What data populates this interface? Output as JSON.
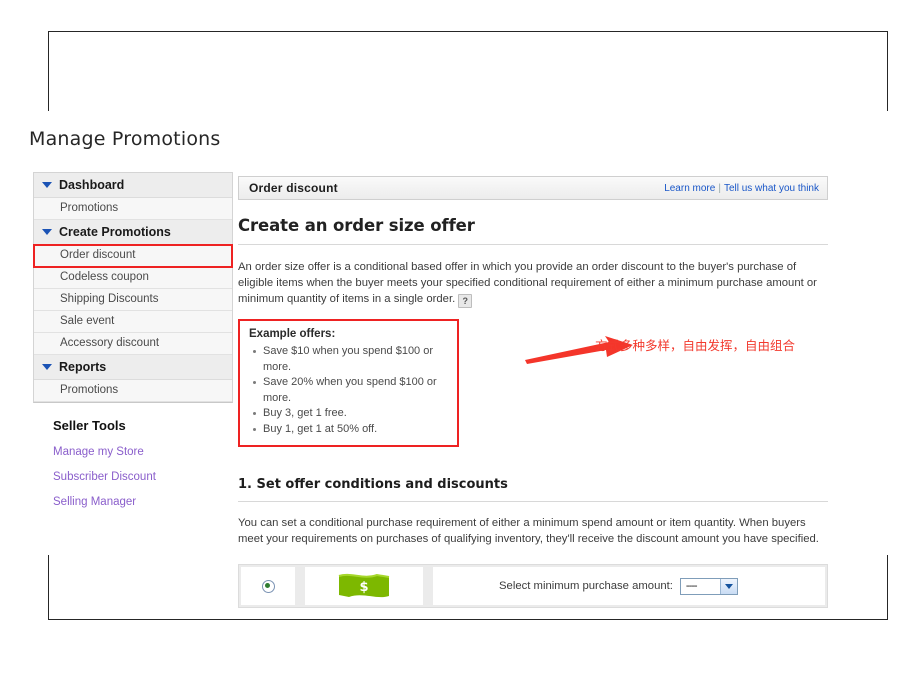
{
  "page": {
    "title": "Manage Promotions"
  },
  "sidebar": {
    "groups": [
      {
        "label": "Dashboard",
        "icon": "triangle-down-icon",
        "items": [
          {
            "label": "Promotions",
            "highlighted": false
          }
        ]
      },
      {
        "label": "Create Promotions",
        "icon": "triangle-down-icon",
        "items": [
          {
            "label": "Order discount",
            "highlighted": true
          },
          {
            "label": "Codeless coupon",
            "highlighted": false
          },
          {
            "label": "Shipping Discounts",
            "highlighted": false
          },
          {
            "label": "Sale event",
            "highlighted": false
          },
          {
            "label": "Accessory discount",
            "highlighted": false
          }
        ]
      },
      {
        "label": "Reports",
        "icon": "triangle-down-icon",
        "items": [
          {
            "label": "Promotions",
            "highlighted": false
          }
        ]
      }
    ],
    "seller_tools": {
      "heading": "Seller Tools",
      "links": [
        "Manage my Store",
        "Subscriber Discount",
        "Selling Manager"
      ]
    }
  },
  "content": {
    "bar": {
      "title": "Order discount",
      "learn_more": "Learn more",
      "separator": "|",
      "feedback": "Tell us what you think"
    },
    "heading": "Create an order size offer",
    "intro": "An order size offer is a conditional based offer in which you provide an order discount to the buyer's purchase of eligible items when the buyer meets your specified conditional requirement of either a minimum purchase amount or minimum quantity of items in a single order.",
    "help_glyph": "?",
    "examples": {
      "title": "Example offers:",
      "items": [
        "Save $10 when you spend $100 or more.",
        "Save 20% when you spend $100 or more.",
        "Buy 3, get 1 free.",
        "Buy 1, get 1 at 50% off."
      ]
    },
    "annotation": {
      "text": "方式多种多样，自由发挥，自由组合",
      "color": "#f23a2e",
      "arrow_icon": "red-arrow-right-icon"
    },
    "section_one": {
      "title": "1. Set offer conditions and discounts",
      "body": "You can set a conditional purchase requirement of either a minimum spend amount or item quantity. When buyers meet your requirements on purchases of qualifying inventory, they'll receive the discount amount you have specified."
    },
    "option_row": {
      "radio_selected": true,
      "icon": "money-bill-icon",
      "icon_glyph": "$",
      "select_label": "Select minimum purchase amount:",
      "select_value": "----",
      "select_arrow_icon": "chevron-down-icon"
    }
  },
  "colors": {
    "annotation_red": "#f23a2e",
    "highlight_red": "#ee2222",
    "link_blue": "#1a57c8",
    "visited_purple": "#8a5ecb",
    "money_green": "#7ab800",
    "triangle_blue": "#1b53b5"
  }
}
